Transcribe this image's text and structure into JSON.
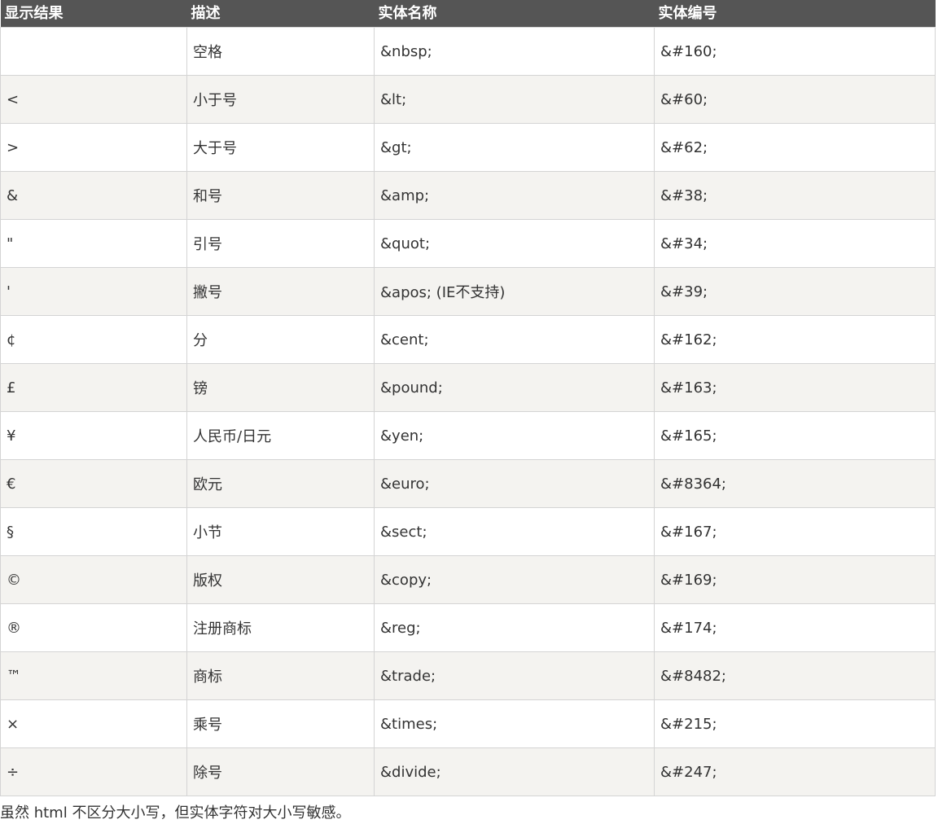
{
  "table": {
    "headers": [
      "显示结果",
      "描述",
      "实体名称",
      "实体编号"
    ],
    "rows": [
      {
        "display": " ",
        "description": "空格",
        "entity_name": "&nbsp;",
        "entity_number": "&#160;"
      },
      {
        "display": "<",
        "description": "小于号",
        "entity_name": "&lt;",
        "entity_number": "&#60;"
      },
      {
        "display": ">",
        "description": "大于号",
        "entity_name": "&gt;",
        "entity_number": "&#62;"
      },
      {
        "display": "&",
        "description": "和号",
        "entity_name": "&amp;",
        "entity_number": "&#38;"
      },
      {
        "display": "\"",
        "description": "引号",
        "entity_name": "&quot;",
        "entity_number": "&#34;"
      },
      {
        "display": "'",
        "description": "撇号",
        "entity_name": "&apos; (IE不支持)",
        "entity_number": "&#39;"
      },
      {
        "display": "¢",
        "description": "分",
        "entity_name": "&cent;",
        "entity_number": "&#162;"
      },
      {
        "display": "£",
        "description": "镑",
        "entity_name": "&pound;",
        "entity_number": "&#163;"
      },
      {
        "display": "¥",
        "description": "人民币/日元",
        "entity_name": "&yen;",
        "entity_number": "&#165;"
      },
      {
        "display": "€",
        "description": "欧元",
        "entity_name": "&euro;",
        "entity_number": "&#8364;"
      },
      {
        "display": "§",
        "description": "小节",
        "entity_name": "&sect;",
        "entity_number": "&#167;"
      },
      {
        "display": "©",
        "description": "版权",
        "entity_name": "&copy;",
        "entity_number": "&#169;"
      },
      {
        "display": "®",
        "description": "注册商标",
        "entity_name": "&reg;",
        "entity_number": "&#174;"
      },
      {
        "display": "™",
        "description": "商标",
        "entity_name": "&trade;",
        "entity_number": "&#8482;"
      },
      {
        "display": "×",
        "description": "乘号",
        "entity_name": "&times;",
        "entity_number": "&#215;"
      },
      {
        "display": "÷",
        "description": "除号",
        "entity_name": "&divide;",
        "entity_number": "&#247;"
      }
    ]
  },
  "note": "虽然 html 不区分大小写，但实体字符对大小写敏感。"
}
